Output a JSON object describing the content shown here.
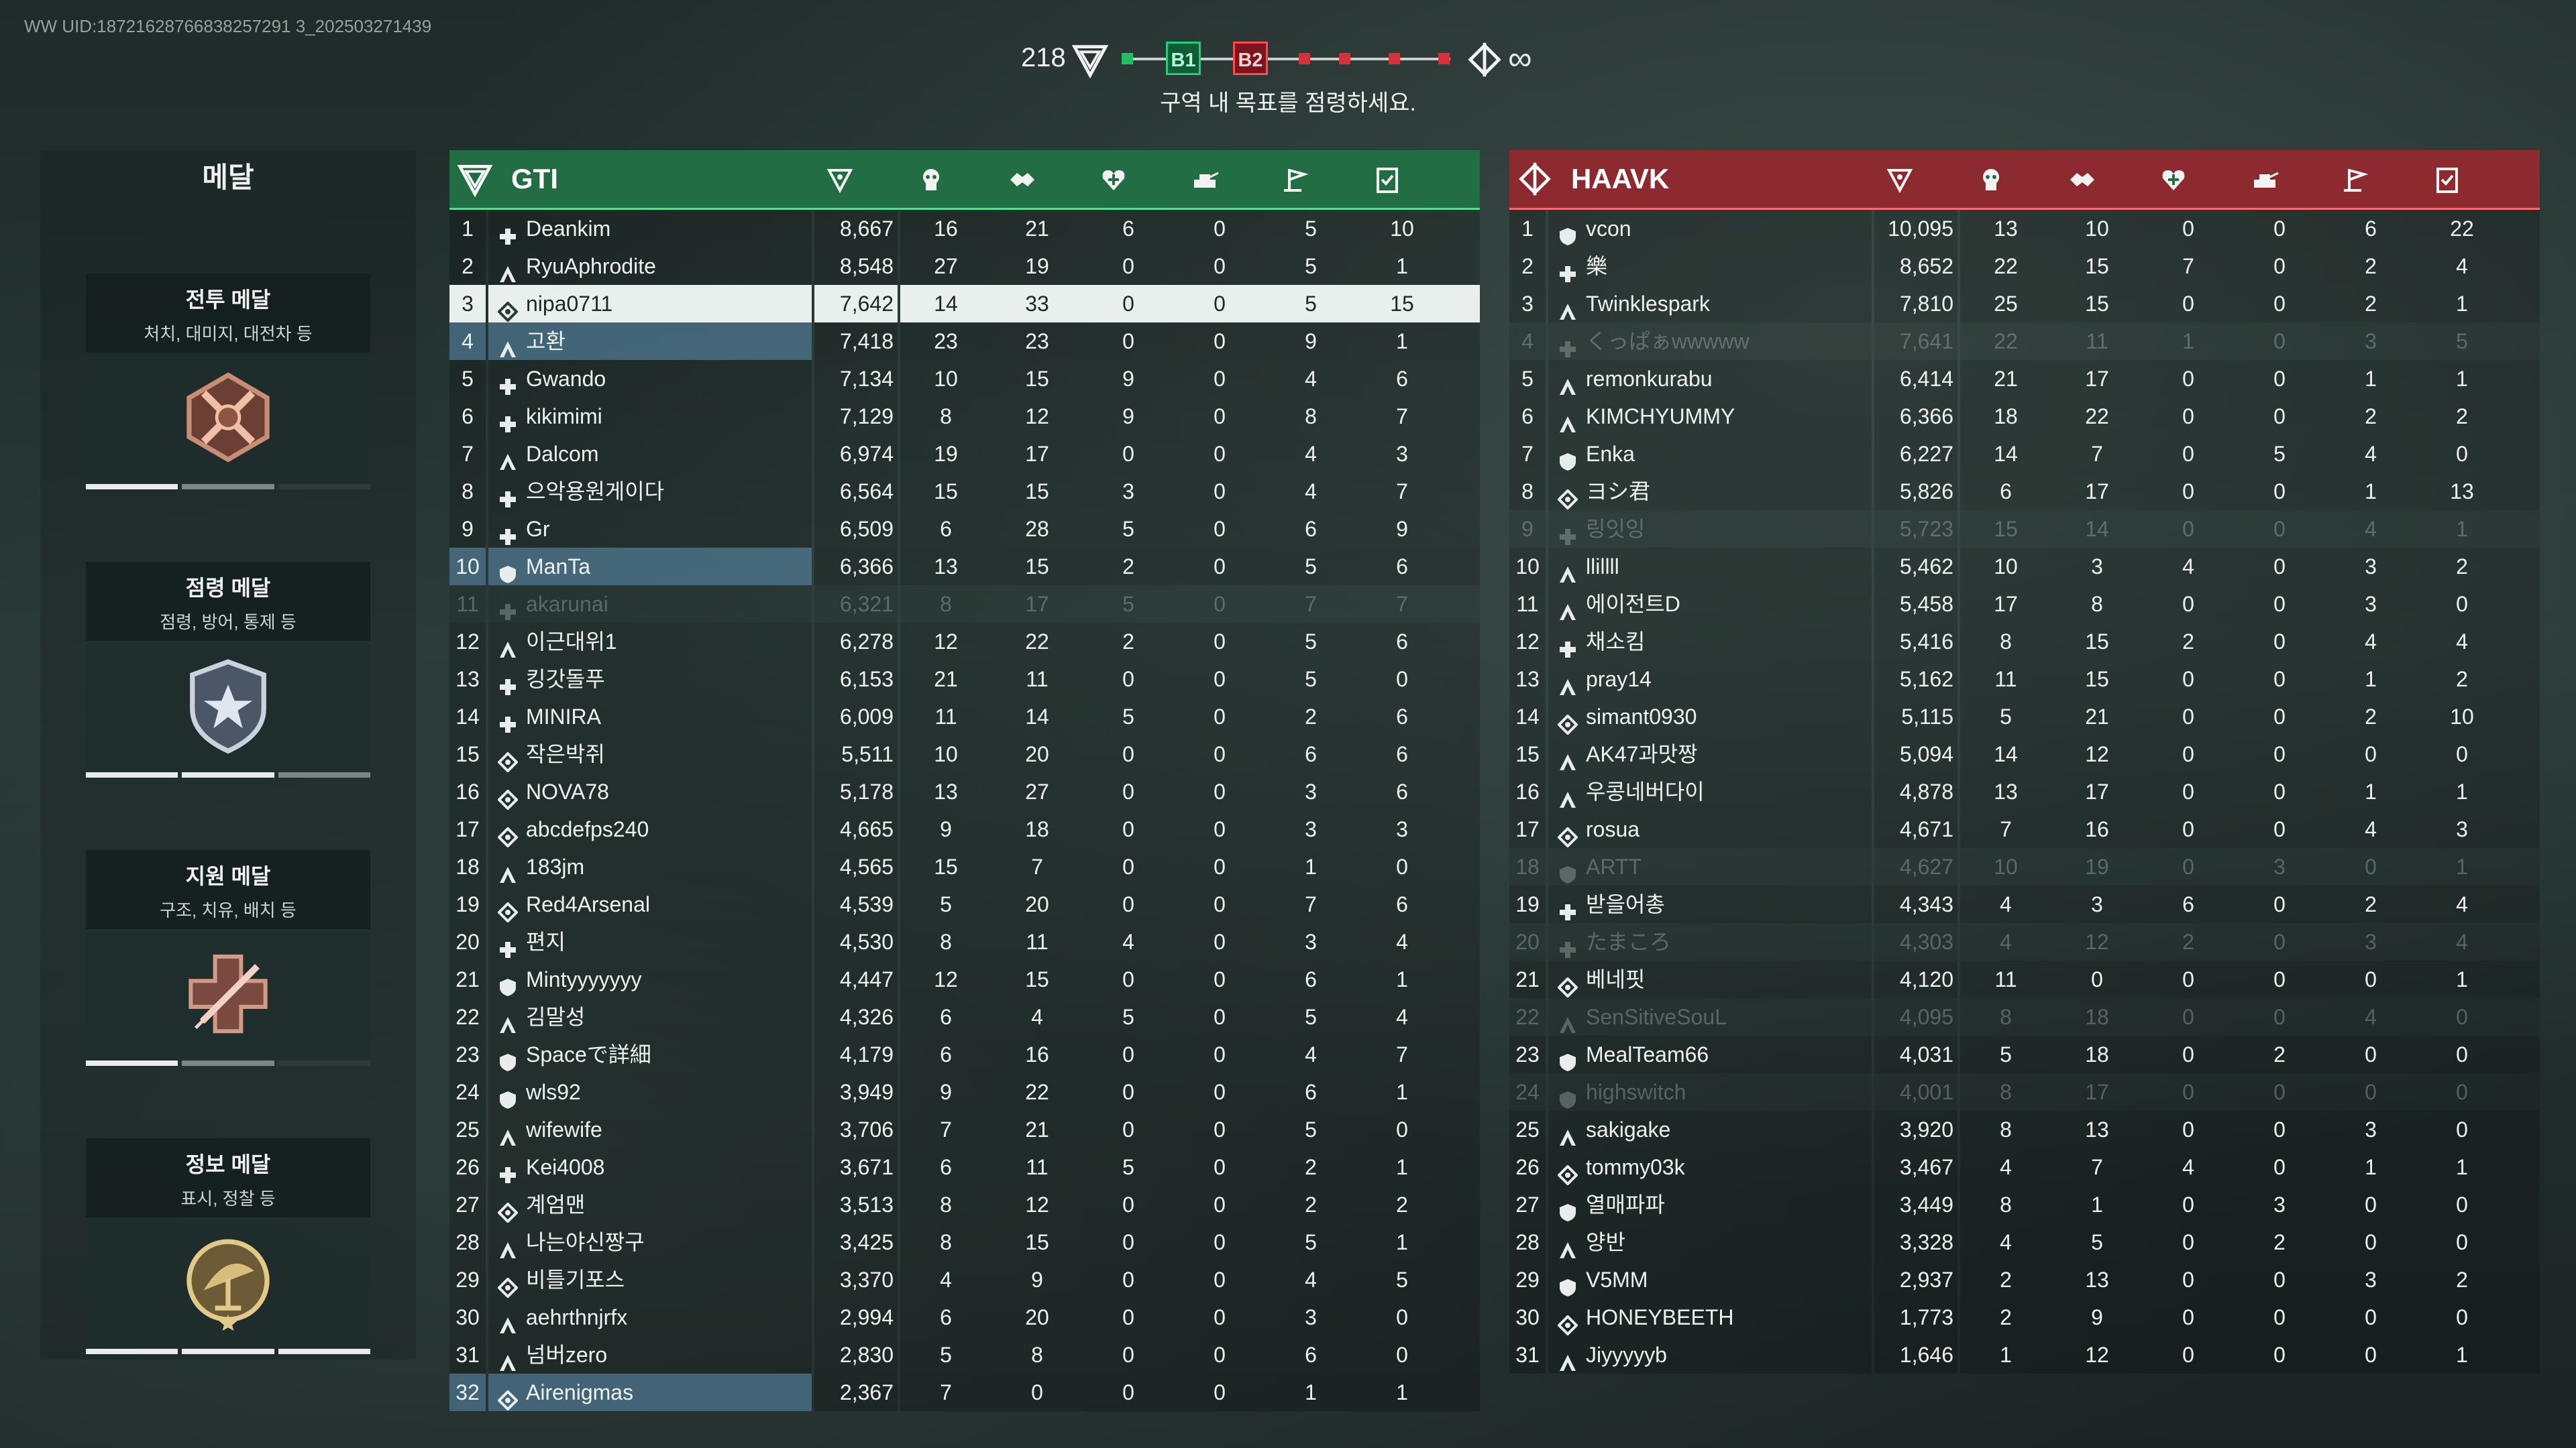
{
  "uid_text": "WW UID:18721628766838257291 3_202503271439",
  "objective": {
    "score": "218",
    "b1": "B1",
    "b2": "B2",
    "tickets": "∞",
    "text": "구역 내 목표를 점령하세요."
  },
  "colors": {
    "gti": "#236d44",
    "haavk": "#8d2a30",
    "self_row": "#e9efec",
    "squad_row": "#5a8caf"
  },
  "medals": {
    "title": "메달",
    "items": [
      {
        "title": "전투 메달",
        "desc": "처치, 대미지, 대전차 등",
        "icon": "crossed-rifles-medal-icon",
        "progress": [
          1,
          0.5,
          0
        ]
      },
      {
        "title": "점령 메달",
        "desc": "점령, 방어, 통제 등",
        "icon": "shield-star-medal-icon",
        "progress": [
          1,
          1,
          0.5
        ]
      },
      {
        "title": "지원 메달",
        "desc": "구조, 치유, 배치 등",
        "icon": "medical-cross-syringe-medal-icon",
        "progress": [
          1,
          0.5,
          0
        ]
      },
      {
        "title": "정보 메달",
        "desc": "표시, 정찰 등",
        "icon": "radar-dish-medal-icon",
        "progress": [
          1,
          1,
          1
        ]
      }
    ]
  },
  "column_icons": [
    "score-icon",
    "kills-icon",
    "assists-icon",
    "revives-icon",
    "vehicle-kills-icon",
    "captures-icon",
    "objectives-icon"
  ],
  "teams": [
    {
      "key": "gti",
      "name": "GTI",
      "logo": "gti-chevron-icon",
      "players": [
        {
          "rank": "1",
          "name": "Deankim",
          "cls": "medic",
          "score": "8,667",
          "stats": [
            "16",
            "21",
            "6",
            "0",
            "5",
            "10"
          ]
        },
        {
          "rank": "2",
          "name": "RyuAphrodite",
          "cls": "assault",
          "score": "8,548",
          "stats": [
            "27",
            "19",
            "0",
            "0",
            "5",
            "1"
          ]
        },
        {
          "rank": "3",
          "name": "nipa0711",
          "cls": "engineer",
          "score": "7,642",
          "stats": [
            "14",
            "33",
            "0",
            "0",
            "5",
            "15"
          ],
          "state": "self"
        },
        {
          "rank": "4",
          "name": "고환",
          "cls": "assault",
          "score": "7,418",
          "stats": [
            "23",
            "23",
            "0",
            "0",
            "9",
            "1"
          ],
          "state": "squad"
        },
        {
          "rank": "5",
          "name": "Gwando",
          "cls": "medic",
          "score": "7,134",
          "stats": [
            "10",
            "15",
            "9",
            "0",
            "4",
            "6"
          ]
        },
        {
          "rank": "6",
          "name": "kikimimi",
          "cls": "medic",
          "score": "7,129",
          "stats": [
            "8",
            "12",
            "9",
            "0",
            "8",
            "7"
          ]
        },
        {
          "rank": "7",
          "name": "Dalcom",
          "cls": "assault",
          "score": "6,974",
          "stats": [
            "19",
            "17",
            "0",
            "0",
            "4",
            "3"
          ]
        },
        {
          "rank": "8",
          "name": "으악용원게이다",
          "cls": "medic",
          "score": "6,564",
          "stats": [
            "15",
            "15",
            "3",
            "0",
            "4",
            "7"
          ]
        },
        {
          "rank": "9",
          "name": "Gr",
          "cls": "medic",
          "score": "6,509",
          "stats": [
            "6",
            "28",
            "5",
            "0",
            "6",
            "9"
          ]
        },
        {
          "rank": "10",
          "name": "ManTa",
          "cls": "support",
          "score": "6,366",
          "stats": [
            "13",
            "15",
            "2",
            "0",
            "5",
            "6"
          ],
          "state": "squad"
        },
        {
          "rank": "11",
          "name": "akarunai",
          "cls": "medic",
          "score": "6,321",
          "stats": [
            "8",
            "17",
            "5",
            "0",
            "7",
            "7"
          ],
          "state": "dim"
        },
        {
          "rank": "12",
          "name": "이근대위1",
          "cls": "assault",
          "score": "6,278",
          "stats": [
            "12",
            "22",
            "2",
            "0",
            "5",
            "6"
          ]
        },
        {
          "rank": "13",
          "name": "킹갓돌푸",
          "cls": "medic",
          "score": "6,153",
          "stats": [
            "21",
            "11",
            "0",
            "0",
            "5",
            "0"
          ]
        },
        {
          "rank": "14",
          "name": "MINIRA",
          "cls": "medic",
          "score": "6,009",
          "stats": [
            "11",
            "14",
            "5",
            "0",
            "2",
            "6"
          ]
        },
        {
          "rank": "15",
          "name": "작은박쥐",
          "cls": "engineer",
          "score": "5,511",
          "stats": [
            "10",
            "20",
            "0",
            "0",
            "6",
            "6"
          ]
        },
        {
          "rank": "16",
          "name": "NOVA78",
          "cls": "engineer",
          "score": "5,178",
          "stats": [
            "13",
            "27",
            "0",
            "0",
            "3",
            "6"
          ]
        },
        {
          "rank": "17",
          "name": "abcdefps240",
          "cls": "engineer",
          "score": "4,665",
          "stats": [
            "9",
            "18",
            "0",
            "0",
            "3",
            "3"
          ]
        },
        {
          "rank": "18",
          "name": "183jm",
          "cls": "assault",
          "score": "4,565",
          "stats": [
            "15",
            "7",
            "0",
            "0",
            "1",
            "0"
          ]
        },
        {
          "rank": "19",
          "name": "Red4Arsenal",
          "cls": "engineer",
          "score": "4,539",
          "stats": [
            "5",
            "20",
            "0",
            "0",
            "7",
            "6"
          ]
        },
        {
          "rank": "20",
          "name": "편지",
          "cls": "medic",
          "score": "4,530",
          "stats": [
            "8",
            "11",
            "4",
            "0",
            "3",
            "4"
          ]
        },
        {
          "rank": "21",
          "name": "Mintyyyyyyy",
          "cls": "support",
          "score": "4,447",
          "stats": [
            "12",
            "15",
            "0",
            "0",
            "6",
            "1"
          ]
        },
        {
          "rank": "22",
          "name": "김말성",
          "cls": "assault",
          "score": "4,326",
          "stats": [
            "6",
            "4",
            "5",
            "0",
            "5",
            "4"
          ]
        },
        {
          "rank": "23",
          "name": "Spaceで詳細",
          "cls": "support",
          "score": "4,179",
          "stats": [
            "6",
            "16",
            "0",
            "0",
            "4",
            "7"
          ]
        },
        {
          "rank": "24",
          "name": "wls92",
          "cls": "support",
          "score": "3,949",
          "stats": [
            "9",
            "22",
            "0",
            "0",
            "6",
            "1"
          ]
        },
        {
          "rank": "25",
          "name": "wifewife",
          "cls": "assault",
          "score": "3,706",
          "stats": [
            "7",
            "21",
            "0",
            "0",
            "5",
            "0"
          ]
        },
        {
          "rank": "26",
          "name": "Kei4008",
          "cls": "medic",
          "score": "3,671",
          "stats": [
            "6",
            "11",
            "5",
            "0",
            "2",
            "1"
          ]
        },
        {
          "rank": "27",
          "name": "계엄맨",
          "cls": "engineer",
          "score": "3,513",
          "stats": [
            "8",
            "12",
            "0",
            "0",
            "2",
            "2"
          ]
        },
        {
          "rank": "28",
          "name": "나는야신짱구",
          "cls": "assault",
          "score": "3,425",
          "stats": [
            "8",
            "15",
            "0",
            "0",
            "5",
            "1"
          ]
        },
        {
          "rank": "29",
          "name": "비틀기포스",
          "cls": "engineer",
          "score": "3,370",
          "stats": [
            "4",
            "9",
            "0",
            "0",
            "4",
            "5"
          ]
        },
        {
          "rank": "30",
          "name": "aehrthnjrfx",
          "cls": "assault",
          "score": "2,994",
          "stats": [
            "6",
            "20",
            "0",
            "0",
            "3",
            "0"
          ]
        },
        {
          "rank": "31",
          "name": "넘버zero",
          "cls": "assault",
          "score": "2,830",
          "stats": [
            "5",
            "8",
            "0",
            "0",
            "6",
            "0"
          ]
        },
        {
          "rank": "32",
          "name": "Airenigmas",
          "cls": "engineer",
          "score": "2,367",
          "stats": [
            "7",
            "0",
            "0",
            "0",
            "1",
            "1"
          ],
          "state": "squad"
        }
      ]
    },
    {
      "key": "haavk",
      "name": "HAAVK",
      "logo": "haavk-emblem-icon",
      "players": [
        {
          "rank": "1",
          "name": "vcon",
          "cls": "support",
          "score": "10,095",
          "stats": [
            "13",
            "10",
            "0",
            "0",
            "6",
            "22"
          ]
        },
        {
          "rank": "2",
          "name": "樂",
          "cls": "medic",
          "score": "8,652",
          "stats": [
            "22",
            "15",
            "7",
            "0",
            "2",
            "4"
          ]
        },
        {
          "rank": "3",
          "name": "Twinklespark",
          "cls": "assault",
          "score": "7,810",
          "stats": [
            "25",
            "15",
            "0",
            "0",
            "2",
            "1"
          ]
        },
        {
          "rank": "4",
          "name": "くっぱぁwwwww",
          "cls": "medic",
          "score": "7,641",
          "stats": [
            "22",
            "11",
            "1",
            "0",
            "3",
            "5"
          ],
          "state": "dim"
        },
        {
          "rank": "5",
          "name": "remonkurabu",
          "cls": "assault",
          "score": "6,414",
          "stats": [
            "21",
            "17",
            "0",
            "0",
            "1",
            "1"
          ]
        },
        {
          "rank": "6",
          "name": "KIMCHYUMMY",
          "cls": "assault",
          "score": "6,366",
          "stats": [
            "18",
            "22",
            "0",
            "0",
            "2",
            "2"
          ]
        },
        {
          "rank": "7",
          "name": "Enka",
          "cls": "support",
          "score": "6,227",
          "stats": [
            "14",
            "7",
            "0",
            "5",
            "4",
            "0"
          ]
        },
        {
          "rank": "8",
          "name": "ヨシ君",
          "cls": "engineer",
          "score": "5,826",
          "stats": [
            "6",
            "17",
            "0",
            "0",
            "1",
            "13"
          ]
        },
        {
          "rank": "9",
          "name": "링잇잉",
          "cls": "medic",
          "score": "5,723",
          "stats": [
            "15",
            "14",
            "0",
            "0",
            "4",
            "1"
          ],
          "state": "dim"
        },
        {
          "rank": "10",
          "name": "llillll",
          "cls": "assault",
          "score": "5,462",
          "stats": [
            "10",
            "3",
            "4",
            "0",
            "3",
            "2"
          ]
        },
        {
          "rank": "11",
          "name": "에이전트D",
          "cls": "assault",
          "score": "5,458",
          "stats": [
            "17",
            "8",
            "0",
            "0",
            "3",
            "0"
          ]
        },
        {
          "rank": "12",
          "name": "채소킴",
          "cls": "medic",
          "score": "5,416",
          "stats": [
            "8",
            "15",
            "2",
            "0",
            "4",
            "4"
          ]
        },
        {
          "rank": "13",
          "name": "pray14",
          "cls": "assault",
          "score": "5,162",
          "stats": [
            "11",
            "15",
            "0",
            "0",
            "1",
            "2"
          ]
        },
        {
          "rank": "14",
          "name": "simant0930",
          "cls": "engineer",
          "score": "5,115",
          "stats": [
            "5",
            "21",
            "0",
            "0",
            "2",
            "10"
          ]
        },
        {
          "rank": "15",
          "name": "AK47과맛짱",
          "cls": "assault",
          "score": "5,094",
          "stats": [
            "14",
            "12",
            "0",
            "0",
            "0",
            "0"
          ]
        },
        {
          "rank": "16",
          "name": "우콩네버다이",
          "cls": "assault",
          "score": "4,878",
          "stats": [
            "13",
            "17",
            "0",
            "0",
            "1",
            "1"
          ]
        },
        {
          "rank": "17",
          "name": "rosua",
          "cls": "engineer",
          "score": "4,671",
          "stats": [
            "7",
            "16",
            "0",
            "0",
            "4",
            "3"
          ]
        },
        {
          "rank": "18",
          "name": "ARTT",
          "cls": "support",
          "score": "4,627",
          "stats": [
            "10",
            "19",
            "0",
            "3",
            "0",
            "1"
          ],
          "state": "dim"
        },
        {
          "rank": "19",
          "name": "받을어총",
          "cls": "medic",
          "score": "4,343",
          "stats": [
            "4",
            "3",
            "6",
            "0",
            "2",
            "4"
          ]
        },
        {
          "rank": "20",
          "name": "たまころ",
          "cls": "medic",
          "score": "4,303",
          "stats": [
            "4",
            "12",
            "2",
            "0",
            "3",
            "4"
          ],
          "state": "dim"
        },
        {
          "rank": "21",
          "name": "베네핏",
          "cls": "engineer",
          "score": "4,120",
          "stats": [
            "11",
            "0",
            "0",
            "0",
            "0",
            "1"
          ]
        },
        {
          "rank": "22",
          "name": "SenSitiveSouL",
          "cls": "assault",
          "score": "4,095",
          "stats": [
            "8",
            "18",
            "0",
            "0",
            "4",
            "0"
          ],
          "state": "dim"
        },
        {
          "rank": "23",
          "name": "MealTeam66",
          "cls": "support",
          "score": "4,031",
          "stats": [
            "5",
            "18",
            "0",
            "2",
            "0",
            "0"
          ]
        },
        {
          "rank": "24",
          "name": "highswitch",
          "cls": "support",
          "score": "4,001",
          "stats": [
            "8",
            "17",
            "0",
            "0",
            "0",
            "0"
          ],
          "state": "dim"
        },
        {
          "rank": "25",
          "name": "sakigake",
          "cls": "assault",
          "score": "3,920",
          "stats": [
            "8",
            "13",
            "0",
            "0",
            "3",
            "0"
          ]
        },
        {
          "rank": "26",
          "name": "tommy03k",
          "cls": "engineer",
          "score": "3,467",
          "stats": [
            "4",
            "7",
            "4",
            "0",
            "1",
            "1"
          ]
        },
        {
          "rank": "27",
          "name": "열매파파",
          "cls": "support",
          "score": "3,449",
          "stats": [
            "8",
            "1",
            "0",
            "3",
            "0",
            "0"
          ]
        },
        {
          "rank": "28",
          "name": "양반",
          "cls": "assault",
          "score": "3,328",
          "stats": [
            "4",
            "5",
            "0",
            "2",
            "0",
            "0"
          ]
        },
        {
          "rank": "29",
          "name": "V5MM",
          "cls": "support",
          "score": "2,937",
          "stats": [
            "2",
            "13",
            "0",
            "0",
            "3",
            "2"
          ]
        },
        {
          "rank": "30",
          "name": "HONEYBEETH",
          "cls": "engineer",
          "score": "1,773",
          "stats": [
            "2",
            "9",
            "0",
            "0",
            "0",
            "0"
          ]
        },
        {
          "rank": "31",
          "name": "Jiyyyyyb",
          "cls": "assault",
          "score": "1,646",
          "stats": [
            "1",
            "12",
            "0",
            "0",
            "0",
            "1"
          ]
        }
      ]
    }
  ]
}
